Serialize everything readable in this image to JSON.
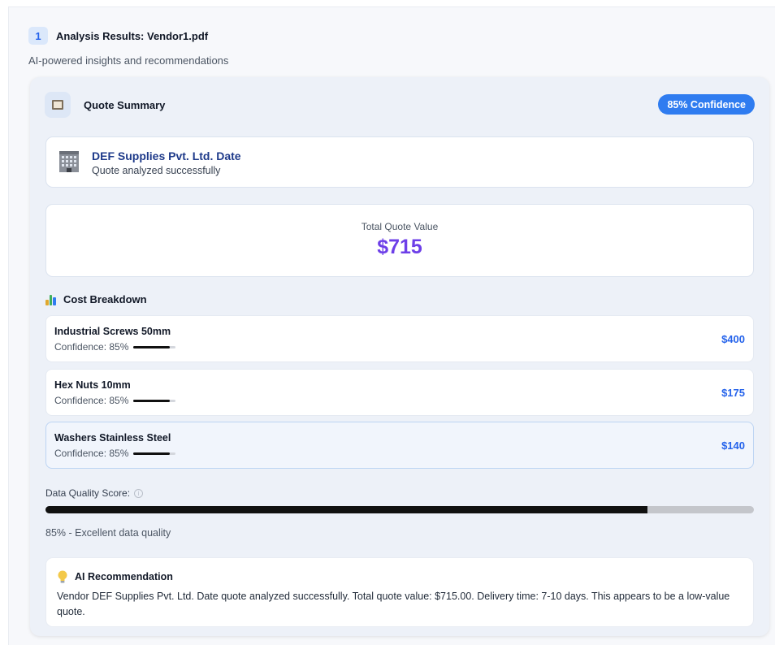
{
  "header": {
    "step_number": "1",
    "title": "Analysis Results: Vendor1.pdf",
    "subtitle": "AI-powered insights and recommendations"
  },
  "quote_summary": {
    "icon": "notepad-icon",
    "title": "Quote Summary",
    "confidence_badge": "85% Confidence"
  },
  "vendor": {
    "icon": "office-building-icon",
    "name": "DEF Supplies Pvt. Ltd. Date",
    "status": "Quote analyzed successfully"
  },
  "total": {
    "label": "Total Quote Value",
    "value": "$715"
  },
  "cost_breakdown": {
    "icon": "bar-chart-icon",
    "title": "Cost Breakdown",
    "items": [
      {
        "name": "Industrial Screws 50mm",
        "confidence": "Confidence: 85%",
        "confidence_fraction": 0.85,
        "amount": "$400",
        "highlighted": false
      },
      {
        "name": "Hex Nuts 10mm",
        "confidence": "Confidence: 85%",
        "confidence_fraction": 0.85,
        "amount": "$175",
        "highlighted": false
      },
      {
        "name": "Washers Stainless Steel",
        "confidence": "Confidence: 85%",
        "confidence_fraction": 0.85,
        "amount": "$140",
        "highlighted": true
      }
    ]
  },
  "data_quality": {
    "label": "Data Quality Score:",
    "info_icon": "info-icon",
    "score_fraction": 0.85,
    "text": "85% - Excellent data quality"
  },
  "ai_recommendation": {
    "icon": "light-bulb-icon",
    "title": "AI Recommendation",
    "text": "Vendor DEF Supplies Pvt. Ltd. Date quote analyzed successfully. Total quote value: $715.00. Delivery time: 7-10 days. This appears to be a low-value quote."
  },
  "colors": {
    "accent": "#2f7cf0",
    "total_value": "#6d3fe8",
    "amount": "#2563eb",
    "vendor_name": "#1e3a8a"
  }
}
